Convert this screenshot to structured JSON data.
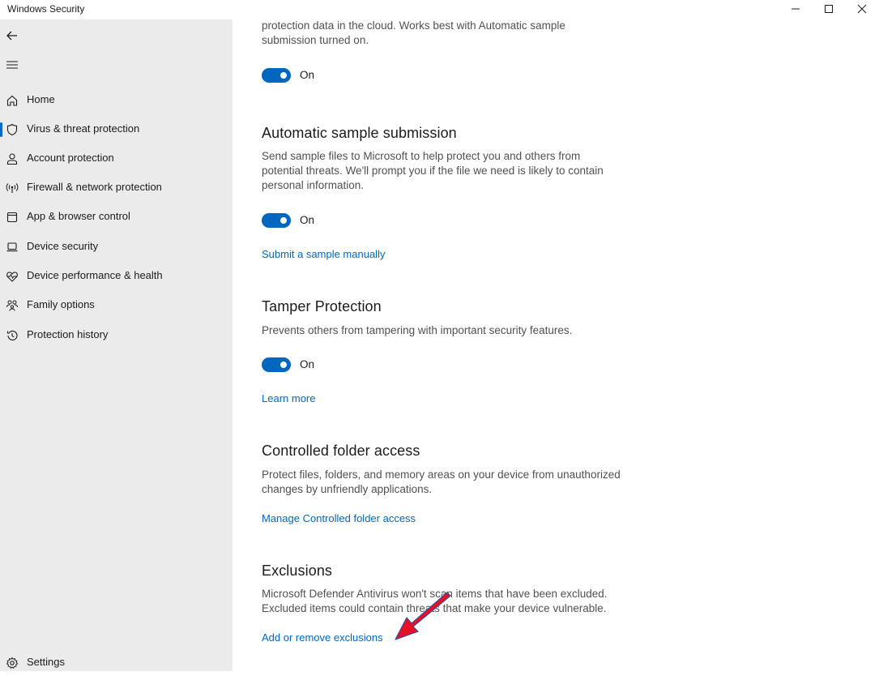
{
  "window": {
    "title": "Windows Security",
    "controls": [
      "minimize-icon",
      "maximize-icon",
      "close-icon"
    ]
  },
  "sidebar": {
    "items": [
      {
        "label": "Home",
        "icon": "home-icon",
        "active": false
      },
      {
        "label": "Virus & threat protection",
        "icon": "shield-icon",
        "active": true
      },
      {
        "label": "Account protection",
        "icon": "person-icon",
        "active": false
      },
      {
        "label": "Firewall & network protection",
        "icon": "antenna-icon",
        "active": false
      },
      {
        "label": "App & browser control",
        "icon": "browser-window-icon",
        "active": false
      },
      {
        "label": "Device security",
        "icon": "laptop-icon",
        "active": false
      },
      {
        "label": "Device performance & health",
        "icon": "heart-pulse-icon",
        "active": false
      },
      {
        "label": "Family options",
        "icon": "family-icon",
        "active": false
      },
      {
        "label": "Protection history",
        "icon": "history-icon",
        "active": false
      }
    ],
    "settings_label": "Settings"
  },
  "main": {
    "cloud": {
      "desc_line1": "protection data in the cloud. Works best with Automatic sample",
      "desc_line2": "submission turned on.",
      "toggle_state": "On"
    },
    "sample": {
      "title": "Automatic sample submission",
      "desc_line1": "Send sample files to Microsoft to help protect you and others from",
      "desc_line2": "potential threats. We'll prompt you if the file we need is likely to contain",
      "desc_line3": "personal information.",
      "toggle_state": "On",
      "link": "Submit a sample manually"
    },
    "tamper": {
      "title": "Tamper Protection",
      "desc": "Prevents others from tampering with important security features.",
      "toggle_state": "On",
      "link": "Learn more"
    },
    "cfa": {
      "title": "Controlled folder access",
      "desc_line1": "Protect files, folders, and memory areas on your device from unauthorized",
      "desc_line2": "changes by unfriendly applications.",
      "link": "Manage Controlled folder access"
    },
    "exclusions": {
      "title": "Exclusions",
      "desc_line1": "Microsoft Defender Antivirus won't scan items that have been excluded.",
      "desc_line2": "Excluded items could contain threats that make your device vulnerable.",
      "link": "Add or remove exclusions"
    }
  },
  "colors": {
    "accent": "#0067c0",
    "sidebar_bg": "#ebebeb",
    "annotation_arrow": "#e81123"
  }
}
